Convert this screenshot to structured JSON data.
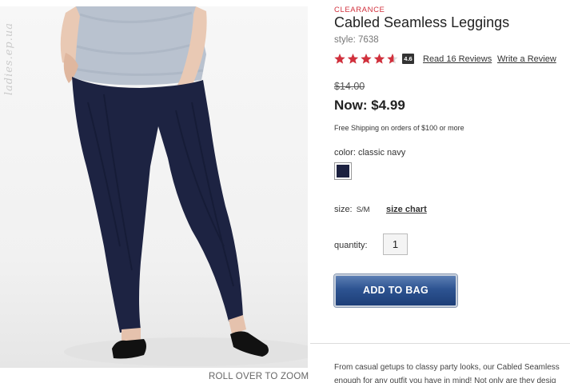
{
  "image": {
    "watermark_text": "ladies.ep.ua",
    "zoom_label": "ROLL OVER TO ZOOM"
  },
  "product": {
    "clearance": "CLEARANCE",
    "title": "Cabled Seamless Leggings",
    "style": "style: 7638",
    "rating": {
      "value": "4.6",
      "stars_filled": 4.6,
      "stars_total": 5,
      "star_color": "#d1303c",
      "reviews_link": "Read 16 Reviews",
      "write_review_link": "Write a Review"
    },
    "original_price": "$14.00",
    "now_price": "Now: $4.99",
    "shipping": "Free Shipping on orders of $100 or more",
    "color": {
      "label": "color:",
      "value": "classic navy",
      "swatch_hex": "#1c2140"
    },
    "size": {
      "label": "size:",
      "value": "S/M",
      "chart_link": "size chart"
    },
    "quantity": {
      "label": "quantity:",
      "value": "1"
    },
    "add_to_bag": "ADD TO BAG",
    "description_lines": [
      "From casual getups to classy party looks, our Cabled Seamless",
      "enough for any outfit you have in mind! Not only are they desig"
    ]
  }
}
